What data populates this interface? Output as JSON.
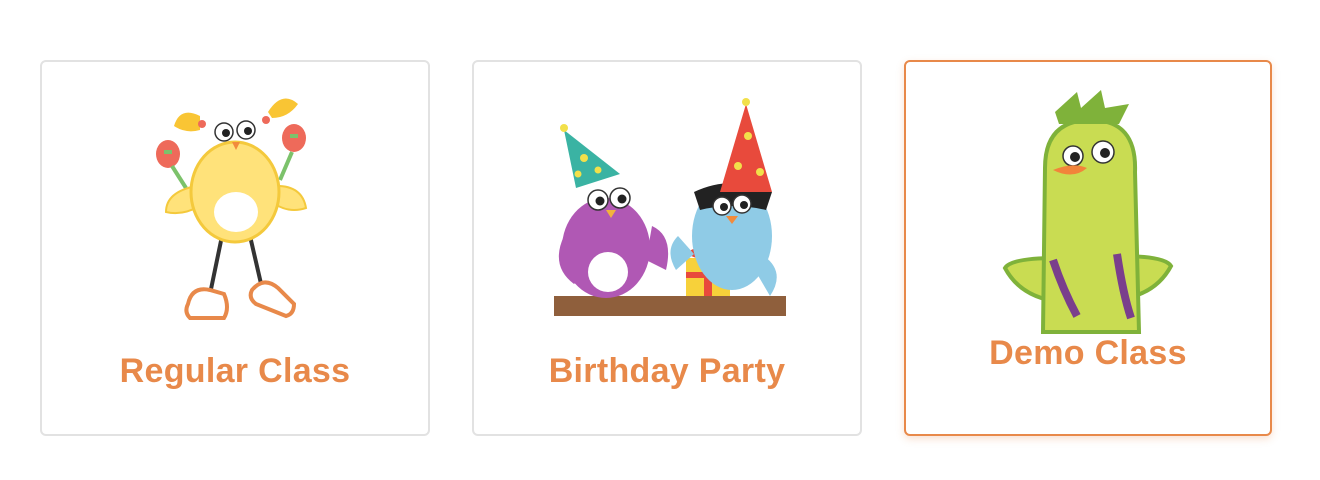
{
  "theme": {
    "accent": "#e8894a",
    "card_border": "#e2e2e2",
    "selected_border": "#e8894a"
  },
  "options": [
    {
      "label": "Regular Class",
      "icon": "yellow-chick-maracas-icon",
      "selected": false
    },
    {
      "label": "Birthday Party",
      "icon": "party-birds-gift-icon",
      "selected": false
    },
    {
      "label": "Demo Class",
      "icon": "green-bird-backpack-icon",
      "selected": true
    }
  ]
}
